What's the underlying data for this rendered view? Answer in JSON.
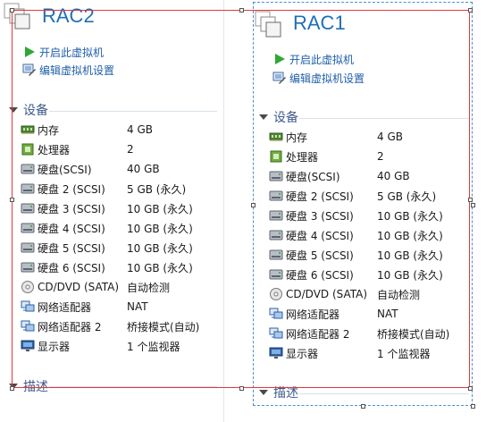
{
  "vm_left": {
    "title": "RAC2",
    "actions": [
      {
        "label": "开启此虚拟机",
        "icon": "play-icon"
      },
      {
        "label": "编辑虚拟机设置",
        "icon": "edit-settings-icon"
      }
    ],
    "devices_header": "设备",
    "description_header": "描述",
    "devices": [
      {
        "name": "内存",
        "value": "4 GB",
        "icon": "memory-icon"
      },
      {
        "name": "处理器",
        "value": "2",
        "icon": "processor-icon"
      },
      {
        "name": "硬盘(SCSI)",
        "value": "40 GB",
        "icon": "hard-disk-icon"
      },
      {
        "name": "硬盘 2 (SCSI)",
        "value": "5 GB (永久)",
        "icon": "hard-disk-icon"
      },
      {
        "name": "硬盘 3 (SCSI)",
        "value": "10 GB (永久)",
        "icon": "hard-disk-icon"
      },
      {
        "name": "硬盘 4 (SCSI)",
        "value": "10 GB (永久)",
        "icon": "hard-disk-icon"
      },
      {
        "name": "硬盘 5 (SCSI)",
        "value": "10 GB (永久)",
        "icon": "hard-disk-icon"
      },
      {
        "name": "硬盘 6 (SCSI)",
        "value": "10 GB (永久)",
        "icon": "hard-disk-icon"
      },
      {
        "name": "CD/DVD (SATA)",
        "value": "自动检测",
        "icon": "cd-dvd-icon"
      },
      {
        "name": "网络适配器",
        "value": "NAT",
        "icon": "network-adapter-icon"
      },
      {
        "name": "网络适配器 2",
        "value": "桥接模式(自动)",
        "icon": "network-adapter-icon"
      },
      {
        "name": "显示器",
        "value": "1 个监视器",
        "icon": "display-icon"
      }
    ]
  },
  "vm_right": {
    "title": "RAC1",
    "actions": [
      {
        "label": "开启此虚拟机",
        "icon": "play-icon"
      },
      {
        "label": "编辑虚拟机设置",
        "icon": "edit-settings-icon"
      }
    ],
    "devices_header": "设备",
    "description_header": "描述",
    "devices": [
      {
        "name": "内存",
        "value": "4 GB",
        "icon": "memory-icon"
      },
      {
        "name": "处理器",
        "value": "2",
        "icon": "processor-icon"
      },
      {
        "name": "硬盘(SCSI)",
        "value": "40 GB",
        "icon": "hard-disk-icon"
      },
      {
        "name": "硬盘 2 (SCSI)",
        "value": "5 GB (永久)",
        "icon": "hard-disk-icon"
      },
      {
        "name": "硬盘 3 (SCSI)",
        "value": "10 GB (永久)",
        "icon": "hard-disk-icon"
      },
      {
        "name": "硬盘 4 (SCSI)",
        "value": "10 GB (永久)",
        "icon": "hard-disk-icon"
      },
      {
        "name": "硬盘 5 (SCSI)",
        "value": "10 GB (永久)",
        "icon": "hard-disk-icon"
      },
      {
        "name": "硬盘 6 (SCSI)",
        "value": "10 GB (永久)",
        "icon": "hard-disk-icon"
      },
      {
        "name": "CD/DVD (SATA)",
        "value": "自动检测",
        "icon": "cd-dvd-icon"
      },
      {
        "name": "网络适配器",
        "value": "NAT",
        "icon": "network-adapter-icon"
      },
      {
        "name": "网络适配器 2",
        "value": "桥接模式(自动)",
        "icon": "network-adapter-icon"
      },
      {
        "name": "显示器",
        "value": "1 个监视器",
        "icon": "display-icon"
      }
    ]
  },
  "colors": {
    "title": "#1f6fb8",
    "action_link": "#1f5fa8",
    "selection_red": "#e0383e",
    "selection_blue": "#4a8fd0"
  }
}
